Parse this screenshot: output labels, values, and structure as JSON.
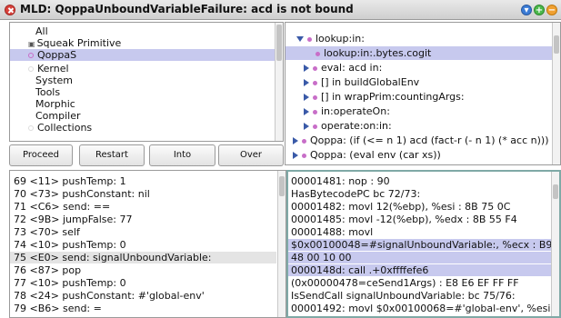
{
  "window": {
    "title": "MLD: QoppaUnboundVariableFailure: acd is not bound",
    "menu_glyph": "▾",
    "expand_glyph": "+",
    "collapse_glyph": "−"
  },
  "categories": [
    {
      "label": "All",
      "marker": "none"
    },
    {
      "label": "Squeak Primitive",
      "marker": "mini"
    },
    {
      "label": "QoppaS",
      "marker": "circle"
    },
    {
      "label": "Kernel",
      "marker": "faint"
    },
    {
      "label": "System",
      "marker": "none"
    },
    {
      "label": "Tools",
      "marker": "none"
    },
    {
      "label": "Morphic",
      "marker": "none"
    },
    {
      "label": "Compiler",
      "marker": "none"
    },
    {
      "label": "Collections",
      "marker": "faint"
    }
  ],
  "category_mini_glyph": "▣",
  "buttons": {
    "proceed": "Proceed",
    "restart": "Restart",
    "into": "Into",
    "over": "Over"
  },
  "stack": [
    {
      "label": "lookup:in:"
    },
    {
      "label": "lookup:in:.bytes.cogit"
    },
    {
      "label": "eval: acd in:"
    },
    {
      "label": "[] in buildGlobalEnv"
    },
    {
      "label": "[] in wrapPrim:countingArgs:"
    },
    {
      "label": "in:operateOn:"
    },
    {
      "label": "operate:on:in:"
    },
    {
      "label": "Qoppa: (if (<= n 1) acd (fact-r (- n 1) (* acc n)))"
    },
    {
      "label": "Qoppa: (eval env (car xs))"
    }
  ],
  "bytecodes": [
    "69 <11> pushTemp: 1",
    "70 <73> pushConstant: nil",
    "71 <C6> send: ==",
    "72 <9B> jumpFalse: 77",
    "73 <70> self",
    "74 <10> pushTemp: 0",
    "75 <E0> send: signalUnboundVariable:",
    "76 <87> pop",
    "77 <10> pushTemp: 0",
    "78 <24> pushConstant: #'global-env'",
    "79 <B6> send: ="
  ],
  "native": [
    "00001481: nop : 90",
    "HasBytecodePC bc 72/73:",
    "00001482: movl 12(%ebp), %esi : 8B 75 0C",
    "00001485: movl -12(%ebp), %edx : 8B 55 F4",
    "00001488: movl",
    "$0x00100048=#signalUnboundVariable:, %ecx : B9",
    "48 00 10 00",
    "0000148d: call .+0xffffefe6",
    "(0x00000478=ceSend1Args) : E8 E6 EF FF FF",
    "IsSendCall signalUnboundVariable: bc 75/76:",
    "00001492: movl $0x00100068=#'global-env', %esi :"
  ],
  "colors": {
    "selection": "#c7c9ee",
    "bytecode_highlight": "#e4e4e4",
    "close": "#d9413b",
    "menu": "#3a7bd5",
    "expand": "#4cb84c",
    "collapse": "#f0a030",
    "frame_marker": "#c86ec8",
    "triangle": "#3a5aa8",
    "native_border": "#7fa9a6"
  }
}
